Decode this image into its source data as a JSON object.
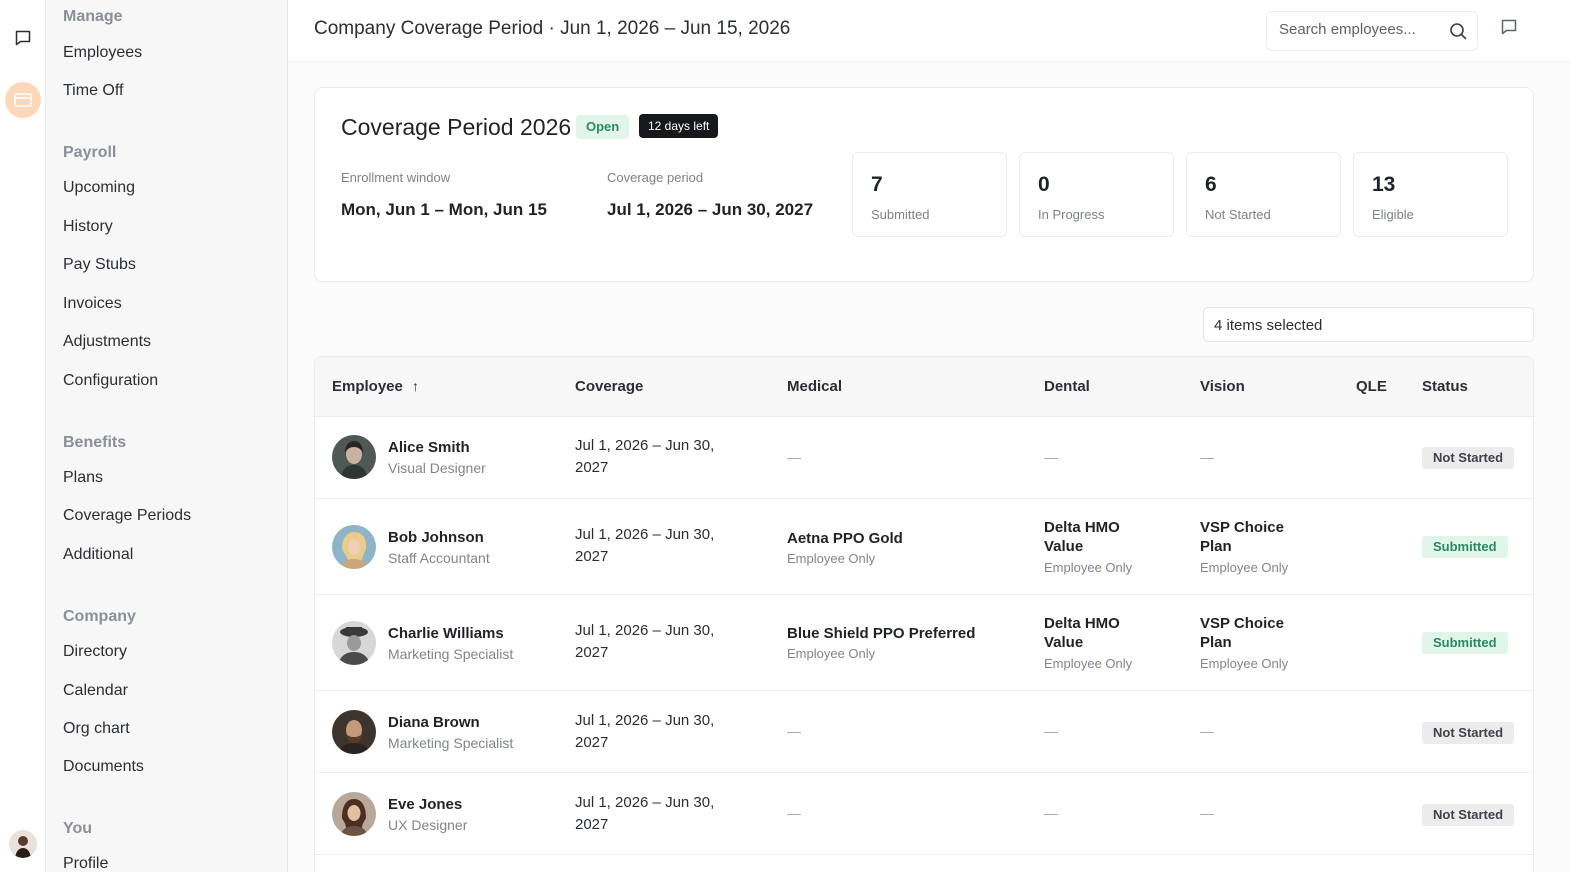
{
  "sidebar": {
    "sections": [
      {
        "label": "Manage",
        "items": [
          "Employees",
          "Time Off"
        ]
      },
      {
        "label": "Payroll",
        "items": [
          "Upcoming",
          "History",
          "Pay Stubs",
          "Invoices",
          "Adjustments",
          "Configuration"
        ]
      },
      {
        "label": "Benefits",
        "items": [
          "Plans",
          "Coverage Periods",
          "Additional"
        ]
      },
      {
        "label": "Company",
        "items": [
          "Directory",
          "Calendar",
          "Org chart",
          "Documents"
        ]
      },
      {
        "label": "You",
        "items": [
          "Profile"
        ]
      }
    ]
  },
  "header": {
    "title": "Company Coverage Period · Jun 1, 2026 – Jun 15, 2026",
    "search_placeholder": "Search employees..."
  },
  "card": {
    "title": "Coverage Period 2026",
    "status_badge": "Open",
    "days_badge": "12 days left",
    "enrollment_label": "Enrollment window",
    "enrollment_value": "Mon, Jun 1 – Mon, Jun 15",
    "coverage_label": "Coverage period",
    "coverage_value": "Jul 1, 2026 – Jun 30, 2027",
    "stats": [
      {
        "value": "7",
        "label": "Submitted"
      },
      {
        "value": "0",
        "label": "In Progress"
      },
      {
        "value": "6",
        "label": "Not Started"
      },
      {
        "value": "13",
        "label": "Eligible"
      }
    ]
  },
  "filter": {
    "selected_label": "4 items selected"
  },
  "table": {
    "headers": [
      "Employee",
      "Coverage",
      "Medical",
      "Dental",
      "Vision",
      "QLE",
      "Status"
    ],
    "sort_indicator": "↑",
    "dash": "—",
    "rows": [
      {
        "name": "Alice Smith",
        "role": "Visual Designer",
        "coverage": "Jul 1, 2026 – Jun 30, 2027",
        "medical": null,
        "dental": null,
        "vision": null,
        "status": "Not Started"
      },
      {
        "name": "Bob Johnson",
        "role": "Staff Accountant",
        "coverage": "Jul 1, 2026 – Jun 30, 2027",
        "medical": {
          "plan": "Aetna PPO Gold",
          "tier": "Employee Only"
        },
        "dental": {
          "plan": "Delta HMO Value",
          "tier": "Employee Only"
        },
        "vision": {
          "plan": "VSP Choice Plan",
          "tier": "Employee Only"
        },
        "status": "Submitted"
      },
      {
        "name": "Charlie Williams",
        "role": "Marketing Specialist",
        "coverage": "Jul 1, 2026 – Jun 30, 2027",
        "medical": {
          "plan": "Blue Shield PPO Preferred",
          "tier": "Employee Only"
        },
        "dental": {
          "plan": "Delta HMO Value",
          "tier": "Employee Only"
        },
        "vision": {
          "plan": "VSP Choice Plan",
          "tier": "Employee Only"
        },
        "status": "Submitted"
      },
      {
        "name": "Diana Brown",
        "role": "Marketing Specialist",
        "coverage": "Jul 1, 2026 – Jun 30, 2027",
        "medical": null,
        "dental": null,
        "vision": null,
        "status": "Not Started"
      },
      {
        "name": "Eve Jones",
        "role": "UX Designer",
        "coverage": "Jul 1, 2026 – Jun 30, 2027",
        "medical": null,
        "dental": null,
        "vision": null,
        "status": "Not Started"
      }
    ]
  },
  "colors": {
    "accent_orange": "#fcd8b9",
    "submitted_green": "#2c8a5e",
    "submitted_bg": "#e2f5ea",
    "dark_badge": "#16181c"
  }
}
